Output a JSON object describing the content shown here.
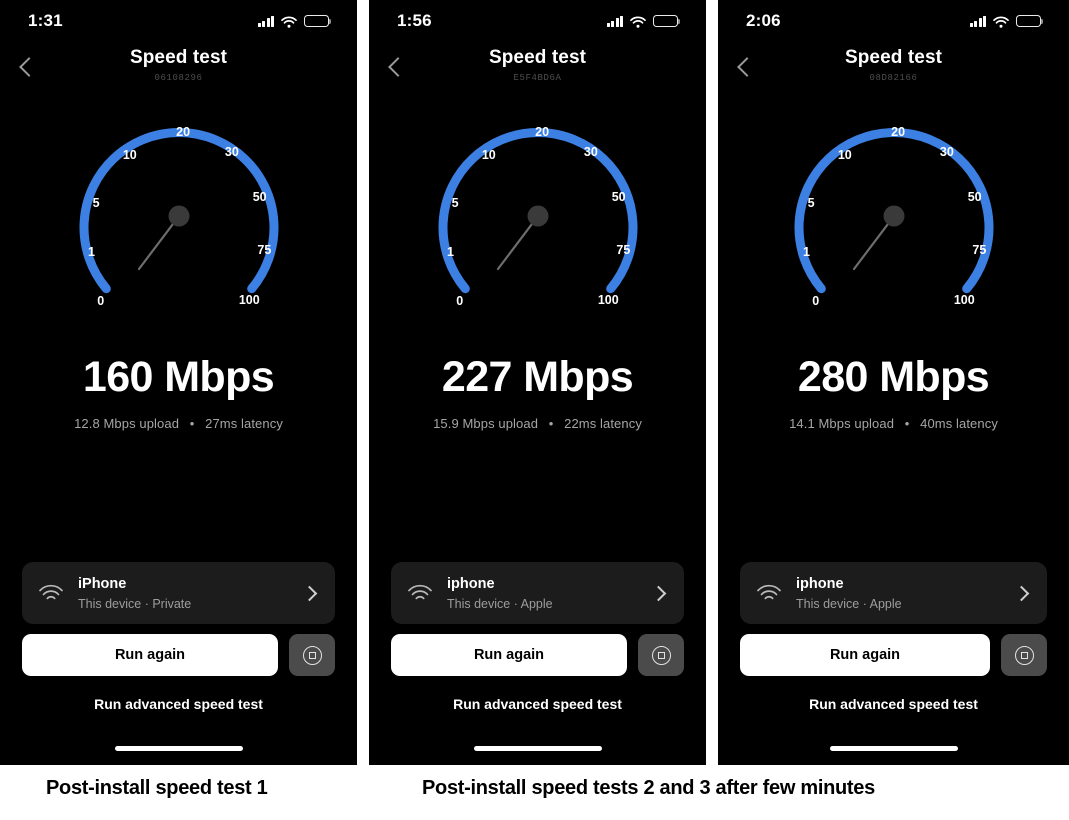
{
  "colors": {
    "arc_blue": "#3d80e4",
    "panel_bg": "#000000",
    "card_bg": "#1c1c1c",
    "accent_text": "#ffffff"
  },
  "gauge": {
    "ticks": [
      "0",
      "1",
      "5",
      "10",
      "20",
      "30",
      "50",
      "75",
      "100"
    ],
    "unit": "Mbps"
  },
  "common": {
    "nav_title": "Speed test",
    "back_label": "Back",
    "run_again_label": "Run again",
    "advanced_label": "Run advanced speed test",
    "stop_icon": "stop-record-icon",
    "wifi_icon": "wifi-icon",
    "signal_icon": "cellular-signal-icon",
    "battery_icon": "battery-icon",
    "chevron_icon": "chevron-right-icon",
    "back_icon": "chevron-left-icon"
  },
  "panels": [
    {
      "status_time": "1:31",
      "nav_title": "Speed test",
      "device_id": "06108296",
      "download": "160 Mbps",
      "upload": "12.8 Mbps upload",
      "separator": "•",
      "latency": "27ms latency",
      "device_name": "iPhone",
      "device_meta": "This device · Private",
      "run_again_label": "Run again",
      "advanced_label": "Run advanced speed test"
    },
    {
      "status_time": "1:56",
      "nav_title": "Speed test",
      "device_id": "E5F4BD6A",
      "download": "227 Mbps",
      "upload": "15.9 Mbps upload",
      "separator": "•",
      "latency": "22ms latency",
      "device_name": "iphone",
      "device_meta": "This device · Apple",
      "run_again_label": "Run again",
      "advanced_label": "Run advanced speed test"
    },
    {
      "status_time": "2:06",
      "nav_title": "Speed test",
      "device_id": "08D82166",
      "download": "280 Mbps",
      "upload": "14.1 Mbps upload",
      "separator": "•",
      "latency": "40ms latency",
      "device_name": "iphone",
      "device_meta": "This device · Apple",
      "run_again_label": "Run again",
      "advanced_label": "Run advanced speed test"
    }
  ],
  "captions": {
    "left": "Post-install speed test 1",
    "right": "Post-install speed tests 2 and 3 after few minutes"
  }
}
